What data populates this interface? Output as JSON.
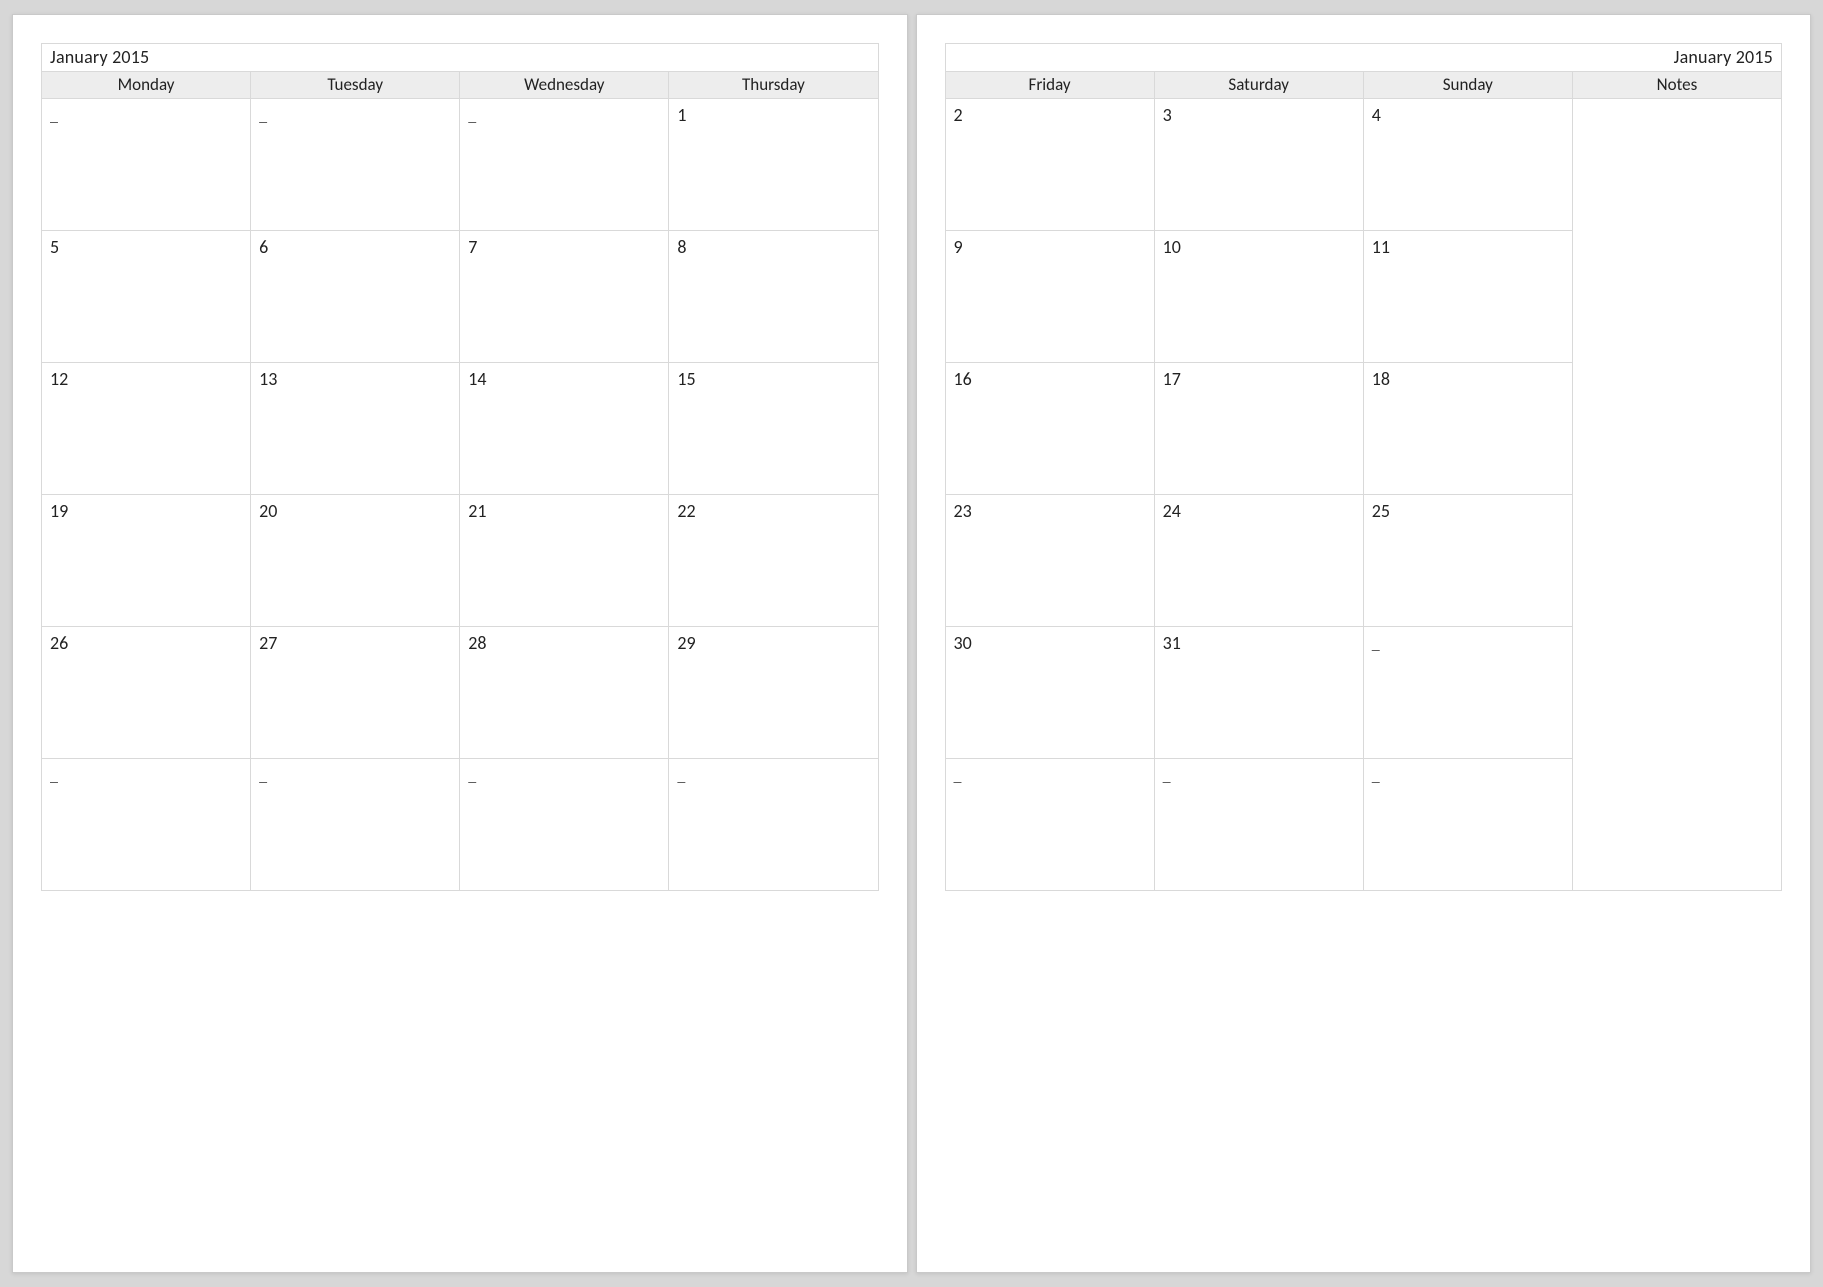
{
  "month_label": "January 2015",
  "placeholder": "_",
  "left": {
    "columns": [
      "Monday",
      "Tuesday",
      "Wednesday",
      "Thursday"
    ],
    "rows": [
      [
        "_",
        "_",
        "_",
        "1"
      ],
      [
        "5",
        "6",
        "7",
        "8"
      ],
      [
        "12",
        "13",
        "14",
        "15"
      ],
      [
        "19",
        "20",
        "21",
        "22"
      ],
      [
        "26",
        "27",
        "28",
        "29"
      ],
      [
        "_",
        "_",
        "_",
        "_"
      ]
    ]
  },
  "right": {
    "columns": [
      "Friday",
      "Saturday",
      "Sunday",
      "Notes"
    ],
    "rows": [
      [
        "2",
        "3",
        "4",
        ""
      ],
      [
        "9",
        "10",
        "11",
        ""
      ],
      [
        "16",
        "17",
        "18",
        ""
      ],
      [
        "23",
        "24",
        "25",
        ""
      ],
      [
        "30",
        "31",
        "_",
        ""
      ],
      [
        "_",
        "_",
        "_",
        ""
      ]
    ]
  }
}
